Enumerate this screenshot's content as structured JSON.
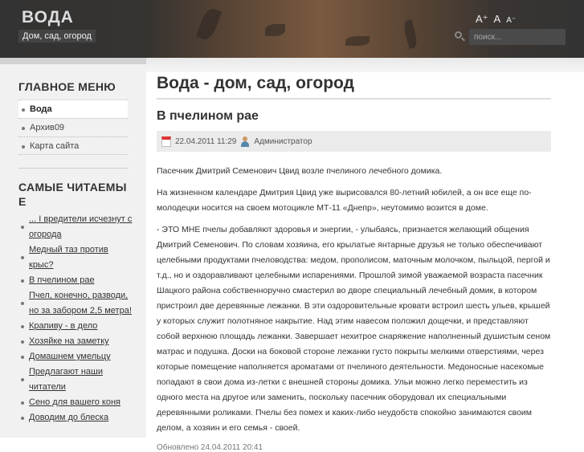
{
  "header": {
    "title": "ВОДА",
    "slogan": "Дом, сад, огород",
    "font_increase": "A⁺",
    "font_reset": "A",
    "font_decrease": "A⁻",
    "search_placeholder": "поиск..."
  },
  "sidebar": {
    "main_menu_title": "ГЛАВНОЕ МЕНЮ",
    "main_menu": [
      {
        "label": "Вода",
        "active": true
      },
      {
        "label": "Архив09"
      },
      {
        "label": "Карта сайта"
      }
    ],
    "popular_title": "САМЫЕ ЧИТАЕМЫЕ",
    "popular": [
      "... I вредители исчезнут с огорода",
      "Медный таз против крыс?",
      "В пчелином рае",
      "Пчел, конечно, разводи, но за забором 2,5 метра!",
      "Крапиву - в дело",
      "Хозяйке на заметку",
      "Домашнем умельцу",
      "Предлагают наши читатели",
      "Сено для вашего коня",
      "Доводим до блеска"
    ]
  },
  "main": {
    "page_title": "Вода - дом, сад, огород",
    "article_title": "В пчелином рае",
    "date": "22.04.2011 11:29",
    "author": "Администратор",
    "paragraphs": [
      "Пасечник Дмитрий Семенович Цвид возле пчелиного лечебного домика.",
      "На жизненном календаре Дмитрия Цвид уже вырисовался 80-летний юбилей, а он все еще по-молодецки носится на своем мотоцикле МТ-11 «Днепр», неутомимо возится в доме.",
      "- ЭТО МНЕ пчелы добавляют здоровья и энергии, - улыбаясь, признается желающий общения Дмитрий Семенович. По словам хозяина, его крылатые янтарные друзья не только обеспечивают целебными продуктами пчеловодства: медом, прополисом, маточным молочком, пыльцой, пергой и т.д., но и оздоравливают целебными испарениями. Прошлой зимой уважаемой возраста пасечник Шацкого района собственноручно смастерил во дворе специальный лечебный домик, в котором пристроил две деревянные лежанки. В эти оздоровительные кровати встроил шесть ульев, крышей у которых служит полотняное накрытие. Над этим навесом положил дощечки, и представляют собой верхнюю площадь лежанки. Завершает нехитрое снаряжение наполненный душистым сеном матрас и подушка. Доски на боковой стороне лежанки густо покрыты мелкими отверстиями, через которые помещение наполняется ароматами от пчелиного деятельности. Медоносные насекомые попадают в свои дома из-летки с внешней стороны домика. Ульи можно легко переместить из одного места на другое или заменить, поскольку пасечник оборудовал их специальными деревянными роликами. Пчелы без помех и каких-либо неудобств спокойно занимаются своим делом, а хозяин и его семья - своей."
    ],
    "updated": "Обновлено 24.04.2011 20:41"
  }
}
